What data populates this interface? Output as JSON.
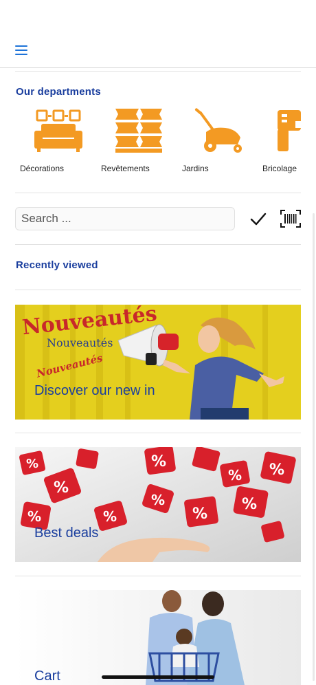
{
  "header": {
    "menu_icon": "hamburger-menu-icon"
  },
  "departments": {
    "title": "Our departments",
    "items": [
      {
        "label": "Décorations",
        "icon": "sofa-icon"
      },
      {
        "label": "Revêtements",
        "icon": "flooring-tiles-icon"
      },
      {
        "label": "Jardins",
        "icon": "lawn-mower-icon"
      },
      {
        "label": "Bricolage",
        "icon": "drill-icon"
      }
    ],
    "icon_color": "#f39a23"
  },
  "search": {
    "placeholder": "Search ...",
    "value": "",
    "confirm_icon": "checkmark-icon",
    "scan_icon": "barcode-scan-icon"
  },
  "recently_viewed": {
    "title": "Recently viewed"
  },
  "banners": [
    {
      "caption": "Discover our new in",
      "headline": "Nouveautés",
      "headline2": "Nouveautés",
      "headline3": "Nouveautés"
    },
    {
      "caption": "Best deals"
    },
    {
      "caption": "Cart"
    }
  ],
  "colors": {
    "accent": "#1a3e9e",
    "menu": "#1e73d8",
    "orange": "#f39a23",
    "banner_yellow": "#e9d51c",
    "deal_red": "#d8202b"
  }
}
